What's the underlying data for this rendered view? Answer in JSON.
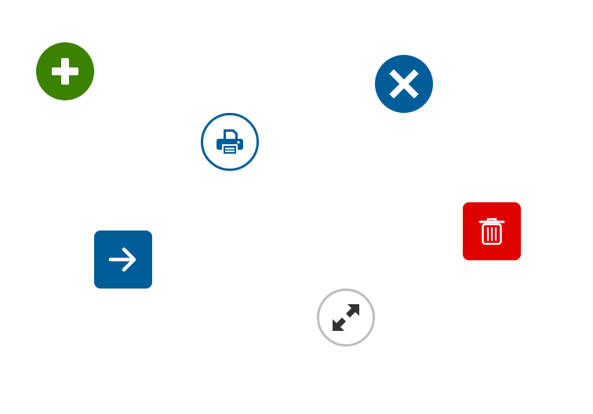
{
  "buttons": {
    "add": {
      "icon": "plus-icon",
      "color": "#3a8200",
      "shape": "circle"
    },
    "close": {
      "icon": "close-icon",
      "color": "#005d99",
      "shape": "circle"
    },
    "print": {
      "icon": "printer-icon",
      "color": "#005d99",
      "shape": "circle-outline"
    },
    "delete": {
      "icon": "trash-icon",
      "color": "#e00000",
      "shape": "rounded-square"
    },
    "next": {
      "icon": "arrow-right-icon",
      "color": "#005d99",
      "shape": "rounded-square"
    },
    "expand": {
      "icon": "expand-icon",
      "color": "#333333",
      "border": "#bdbdbd",
      "shape": "circle-outline"
    }
  }
}
